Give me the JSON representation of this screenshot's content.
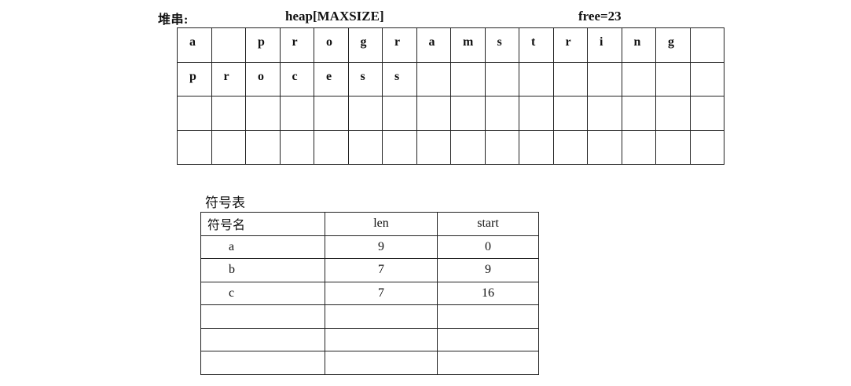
{
  "heap": {
    "label": "堆串:",
    "name": "heap[MAXSIZE]",
    "free": "free=23",
    "rows": [
      [
        "a",
        "",
        "p",
        "r",
        "o",
        "g",
        "r",
        "a",
        "m",
        "s",
        "t",
        "r",
        "i",
        "n",
        "g",
        ""
      ],
      [
        "p",
        "r",
        "o",
        "c",
        "e",
        "s",
        "s",
        "",
        "",
        "",
        "",
        "",
        "",
        "",
        "",
        ""
      ],
      [
        "",
        "",
        "",
        "",
        "",
        "",
        "",
        "",
        "",
        "",
        "",
        "",
        "",
        "",
        "",
        ""
      ],
      [
        "",
        "",
        "",
        "",
        "",
        "",
        "",
        "",
        "",
        "",
        "",
        "",
        "",
        "",
        "",
        ""
      ]
    ]
  },
  "symbol_table": {
    "title": "符号表",
    "headers": [
      "符号名",
      "len",
      "start"
    ],
    "rows": [
      [
        "a",
        "9",
        "0"
      ],
      [
        "b",
        "7",
        "9"
      ],
      [
        "c",
        "7",
        "16"
      ],
      [
        "",
        "",
        ""
      ],
      [
        "",
        "",
        ""
      ],
      [
        "",
        "",
        ""
      ]
    ]
  }
}
